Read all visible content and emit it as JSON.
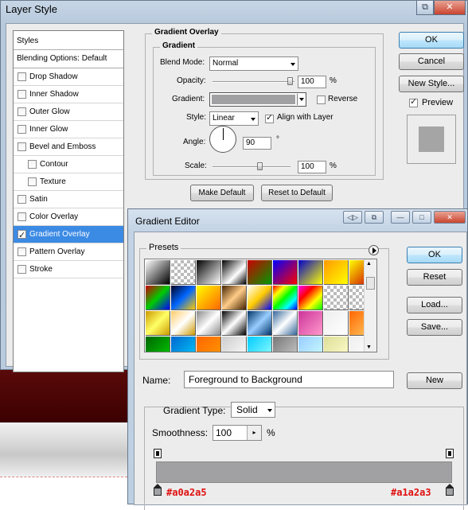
{
  "layer_style": {
    "title": "Layer Style",
    "list_header": "Styles",
    "blending_header": "Blending Options: Default",
    "items": [
      {
        "label": "Drop Shadow",
        "checked": false
      },
      {
        "label": "Inner Shadow",
        "checked": false
      },
      {
        "label": "Outer Glow",
        "checked": false
      },
      {
        "label": "Inner Glow",
        "checked": false
      },
      {
        "label": "Bevel and Emboss",
        "checked": false
      },
      {
        "label": "Contour",
        "checked": false
      },
      {
        "label": "Texture",
        "checked": false
      },
      {
        "label": "Satin",
        "checked": false
      },
      {
        "label": "Color Overlay",
        "checked": false
      },
      {
        "label": "Gradient Overlay",
        "checked": true
      },
      {
        "label": "Pattern Overlay",
        "checked": false
      },
      {
        "label": "Stroke",
        "checked": false
      }
    ],
    "group_title": "Gradient Overlay",
    "subgroup_title": "Gradient",
    "blend_mode_label": "Blend Mode:",
    "blend_mode_value": "Normal",
    "opacity_label": "Opacity:",
    "opacity_value": "100",
    "opacity_unit": "%",
    "gradient_label": "Gradient:",
    "reverse_label": "Reverse",
    "style_label": "Style:",
    "style_value": "Linear",
    "align_label": "Align with Layer",
    "angle_label": "Angle:",
    "angle_value": "90",
    "angle_unit": "°",
    "scale_label": "Scale:",
    "scale_value": "100",
    "scale_unit": "%",
    "make_default": "Make Default",
    "reset_default": "Reset to Default",
    "ok": "OK",
    "cancel": "Cancel",
    "new_style": "New Style...",
    "preview_label": "Preview"
  },
  "gradient_editor": {
    "title": "Gradient Editor",
    "presets_label": "Presets",
    "ok": "OK",
    "reset": "Reset",
    "load": "Load...",
    "save": "Save...",
    "name_label": "Name:",
    "name_value": "Foreground to Background",
    "new_button": "New",
    "gradient_type_label": "Gradient Type:",
    "gradient_type_value": "Solid",
    "smoothness_label": "Smoothness:",
    "smoothness_value": "100",
    "smoothness_unit": "%",
    "left_stop_color": "#a0a2a5",
    "right_stop_color": "#a1a2a3"
  },
  "colors": {
    "selection_blue": "#3b8ae4",
    "annotation_red": "#e01010",
    "gradient_grey": "#a1a1a3"
  }
}
